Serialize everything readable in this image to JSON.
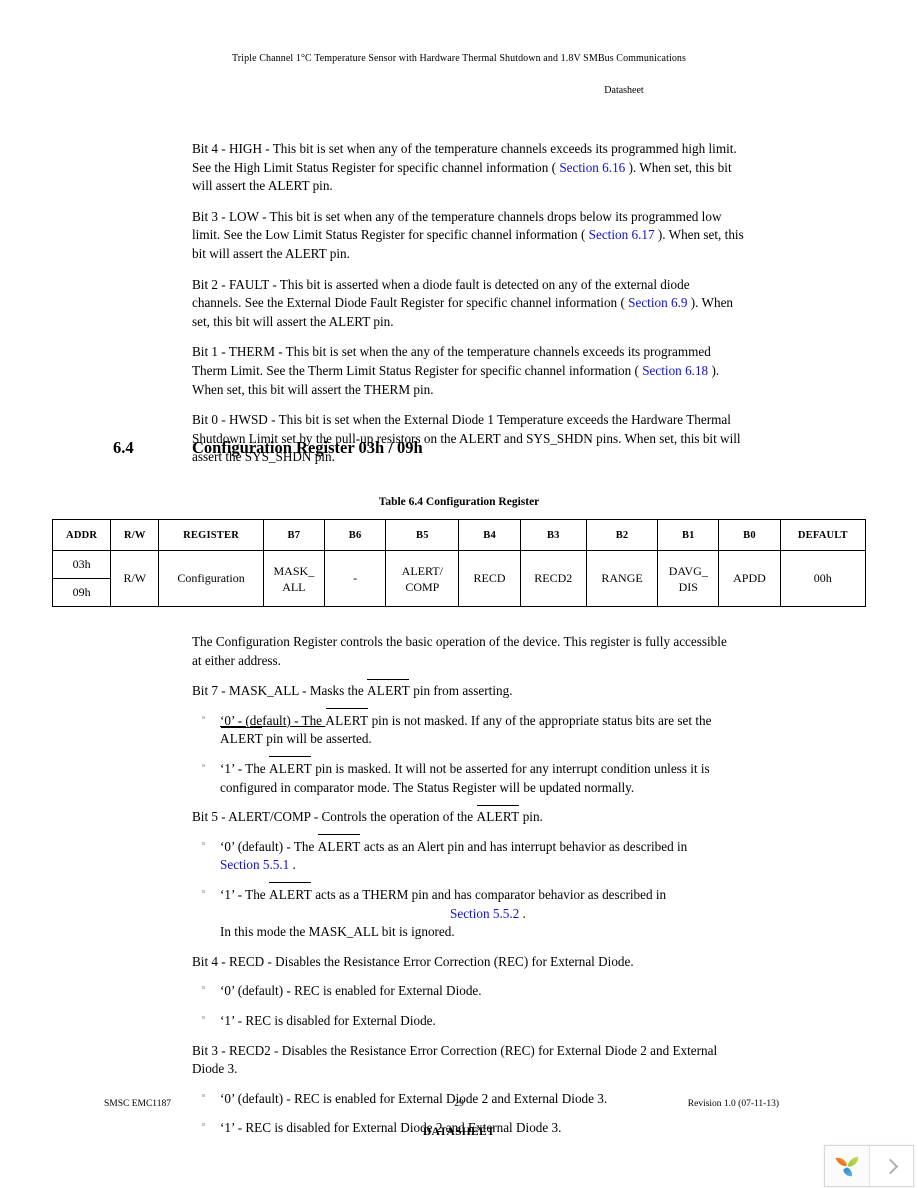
{
  "header": {
    "title": "Triple Channel 1°C Temperature Sensor with Hardware Thermal Shutdown and 1.8V SMBus Communications",
    "doc_type": "Datasheet"
  },
  "bit_descriptions": [
    {
      "id": "bit4-high",
      "line1": "Bit 4 - HIGH - This bit is set when any of the temperature channels exceeds its programmed high limit.",
      "line2_pre": "See the High Limit Status Register for specific channel information (",
      "link": "Section 6.16",
      "line2_post": "). When set, this bit",
      "line3": "will assert the ALERT pin."
    },
    {
      "id": "bit3-low",
      "line1": "Bit 3 - LOW - This bit is set when any of the temperature channels drops below its programmed low",
      "line2_pre": "limit. See the Low Limit Status Register for specific channel information (",
      "link": "Section 6.17",
      "line2_post": "). When set, this",
      "line3": "bit will assert the ALERT pin."
    },
    {
      "id": "bit2-fault",
      "line1": "Bit 2 - FAULT - This bit is asserted when a diode fault is detected on any of the external diode",
      "line2_pre": "channels. See the External Diode Fault Register for specific channel information (",
      "link": "Section 6.9",
      "line2_post": "). When",
      "line3": "set, this bit will assert the ALERT pin."
    },
    {
      "id": "bit1-therm",
      "line1": "Bit 1 - THERM - This bit is set when the any of the temperature channels exceeds its programmed",
      "line2_pre": "Therm Limit. See the Therm Limit Status Register for specific channel information (",
      "link": "Section 6.18",
      "line2_post": ").",
      "line3": "When set, this bit will assert the THERM pin."
    },
    {
      "id": "bit0-hwsd",
      "line1": "Bit 0 - HWSD - This bit is set when the External Diode 1 Temperature exceeds the Hardware Thermal",
      "line2_pre": "Shutdown Limit set by the pull-up resistors on the ALERT and SYS_SHDN pins. When set, this bit will",
      "link": "",
      "line2_post": "",
      "line3": "assert the SYS_SHDN pin."
    }
  ],
  "section": {
    "number": "6.4",
    "title": "Configuration Register 03h / 09h"
  },
  "table": {
    "caption": "Table 6.4  Configuration Register",
    "headers": [
      "ADDR",
      "R/W",
      "REGISTER",
      "B7",
      "B6",
      "B5",
      "B4",
      "B3",
      "B2",
      "B1",
      "B0",
      "DEFAULT"
    ],
    "addresses": [
      "03h",
      "09h"
    ],
    "row": {
      "rw": "R/W",
      "register": "Configuration",
      "b7_line1": "MASK_",
      "b7_line2": "ALL",
      "b6": "-",
      "b5_line1": "ALERT/",
      "b5_line2": "COMP",
      "b4": "RECD",
      "b3": "RECD2",
      "b2": "RANGE",
      "b1_line1": "DAVG_",
      "b1_line2": "DIS",
      "b0": "APDD",
      "default": "00h"
    }
  },
  "body": {
    "intro_line1": "The Configuration Register controls the basic operation of the device. This register is fully accessible",
    "intro_line2": "at either address.",
    "bit7": {
      "heading_pre": "Bit 7 - MASK_ALL - Masks the ",
      "heading_signal": "ALERT",
      "heading_post": " pin from asserting.",
      "opt0_pre": "‘0’ - (default) - The ",
      "opt0_signal": "ALERT",
      "opt0_post": "  pin is not masked. If any of the appropriate status bits are set the",
      "opt0_line2_signal": "ALERT",
      "opt0_line2_post": "  pin will be asserted.",
      "opt1_pre": "‘1’ - The ",
      "opt1_signal": "ALERT",
      "opt1_post": " pin is masked. It will not be asserted for any interrupt condition unless it is",
      "opt1_line2": "configured in comparator mode. The Status Register will be updated normally."
    },
    "bit5": {
      "heading_pre": "Bit 5 - ALERT/COMP - Controls the operation of the ",
      "heading_signal": "ALERT",
      "heading_post": "  pin.",
      "opt0_pre": "‘0’ (default) - The ",
      "opt0_signal": "ALERT",
      "opt0_post": "  acts as an Alert pin and has interrupt behavior as described in",
      "opt0_link": "Section 5.5.1",
      "opt0_tail": ".",
      "opt1_pre": "‘1’ - The ",
      "opt1_signal": "ALERT",
      "opt1_post": "  acts as a THERM pin and has comparator behavior as described in",
      "opt1_link": "Section 5.5.2",
      "opt1_tail": ".",
      "opt1_line2": "In this mode the MASK_ALL bit is ignored."
    },
    "bit4": {
      "heading": "Bit 4 - RECD - Disables the Resistance Error Correction (REC) for External Diode.",
      "opt0": "‘0’ (default) - REC is enabled for External Diode.",
      "opt1": "‘1’ - REC is disabled for External Diode."
    },
    "bit3": {
      "heading_line1": "Bit 3 - RECD2 - Disables the Resistance Error Correction (REC) for External Diode 2 and External",
      "heading_line2": "Diode 3.",
      "opt0": "‘0’ (default) - REC is enabled for External Diode 2 and External Diode 3.",
      "opt1": "‘1’ - REC is disabled for External Diode 2 and External Diode 3."
    }
  },
  "footer": {
    "left": "SMSC EMC1187",
    "page": "29",
    "right": "Revision 1.0 (07-11-13)",
    "doc_label": "DATASHEET"
  },
  "widget": {
    "logo_name": "pinwheel-logo",
    "next_label": "›"
  },
  "colors": {
    "link": "#1010cf",
    "text": "#000000",
    "background": "#ffffff"
  }
}
